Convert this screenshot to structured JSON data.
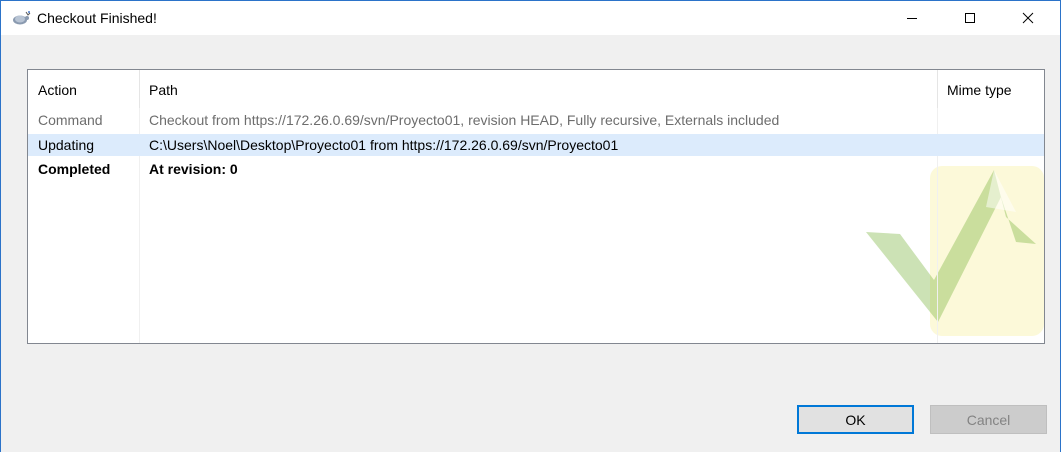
{
  "window": {
    "title": "Checkout Finished!",
    "icon": "tortoisesvn-icon"
  },
  "titlebar_buttons": [
    "minimize",
    "maximize",
    "close"
  ],
  "list": {
    "columns": [
      "Action",
      "Path",
      "Mime type"
    ],
    "rows": [
      {
        "action": "Command",
        "path": "Checkout from https://172.26.0.69/svn/Proyecto01, revision HEAD, Fully recursive, Externals included",
        "mime": "",
        "style": "gray"
      },
      {
        "action": "Updating",
        "path": "C:\\Users\\Noel\\Desktop\\Proyecto01 from https://172.26.0.69/svn/Proyecto01",
        "mime": "",
        "style": "selected"
      },
      {
        "action": "Completed",
        "path": "At revision: 0",
        "mime": "",
        "style": "bold"
      }
    ]
  },
  "buttons": {
    "ok": "OK",
    "cancel": "Cancel"
  },
  "colors": {
    "accent": "#0078d7",
    "selected_row": "#dcebfc",
    "watermark_green": "#78b43c"
  }
}
